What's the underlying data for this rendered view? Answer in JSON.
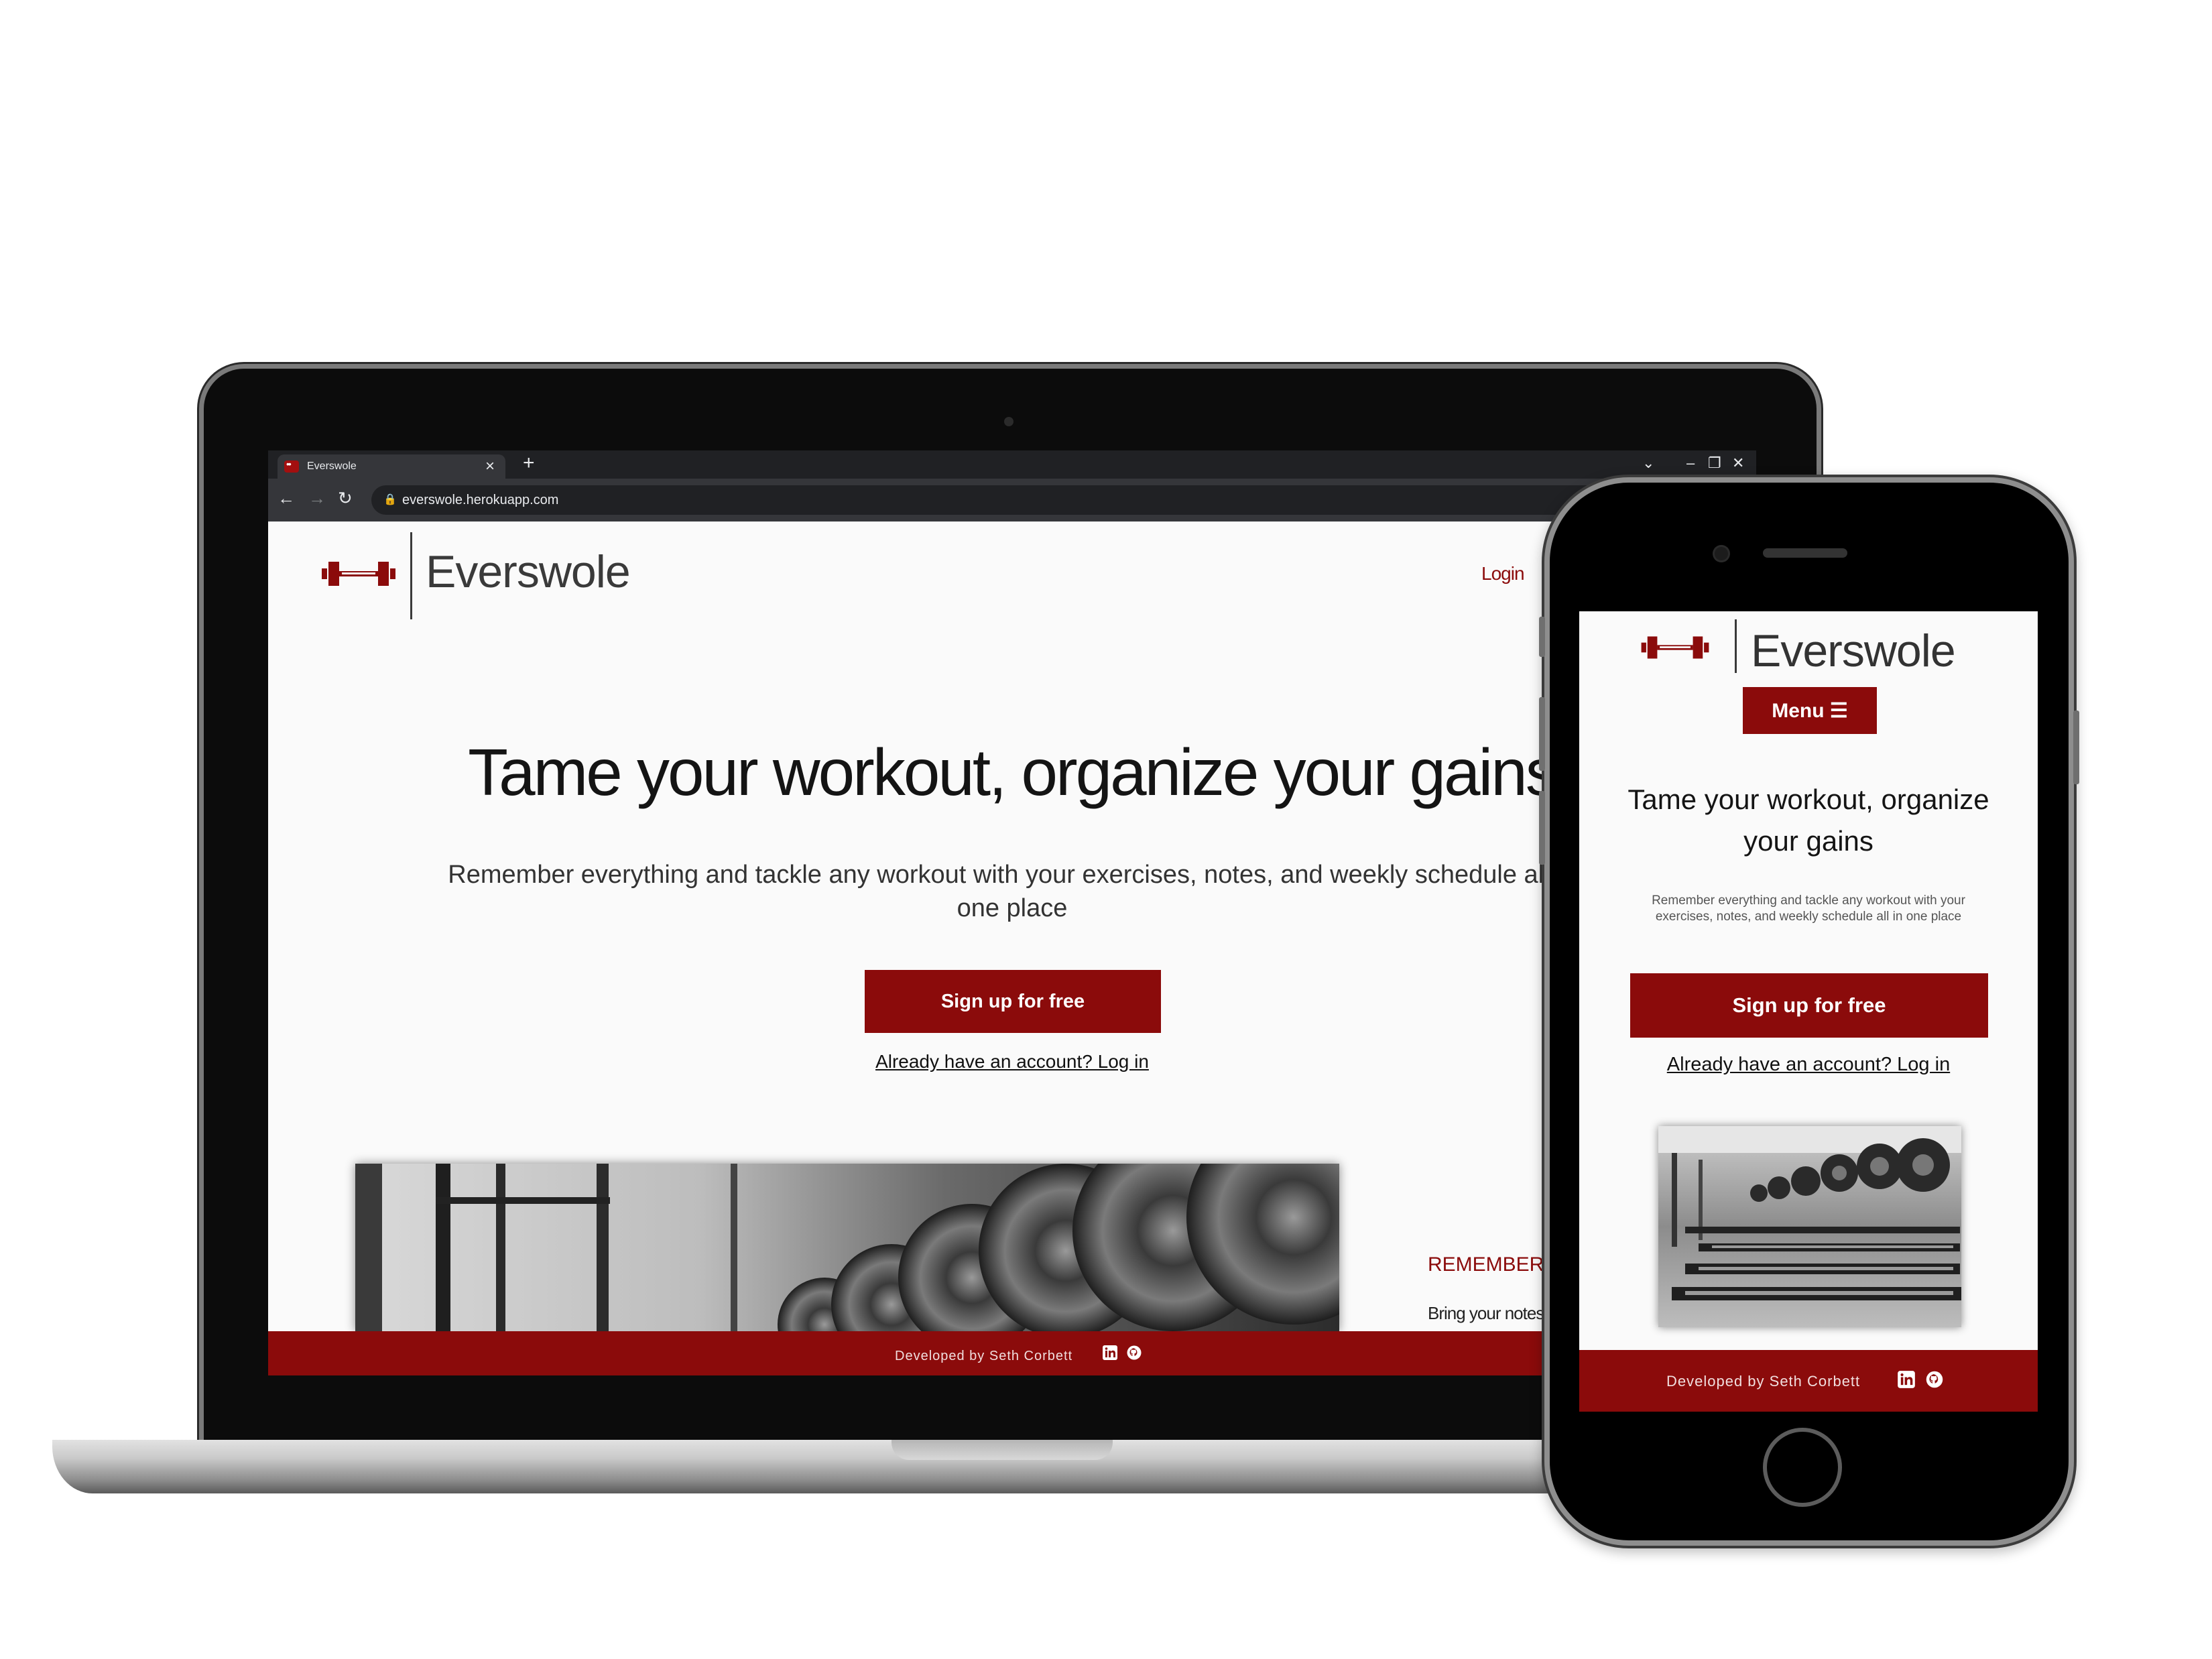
{
  "browser": {
    "tab_title": "Everswole",
    "tab_close": "×",
    "tab_new": "+",
    "url": "everswole.herokuapp.com",
    "window_controls": {
      "dropdown": "⌄",
      "minimize": "–",
      "restore": "❐",
      "close": "✕"
    },
    "nav": {
      "back": "←",
      "forward": "→",
      "reload": "↻"
    }
  },
  "brand": {
    "name": "Everswole",
    "accent": "#8b0b0b"
  },
  "desktop": {
    "nav": {
      "login": "Login"
    },
    "hero": {
      "title": "Tame your workout, organize your gains",
      "subtitle": "Remember everything and tackle any workout with your exercises, notes, and weekly schedule all in one place",
      "signup_label": "Sign up for free",
      "login_prompt": "Already have an account? Log in"
    },
    "feature": {
      "heading": "REMEMBER E",
      "text": "Bring your notes,"
    },
    "footer": {
      "credit": "Developed by Seth Corbett"
    }
  },
  "mobile": {
    "menu_label": "Menu ☰",
    "hero": {
      "title": "Tame your workout, organize your gains",
      "subtitle": "Remember everything and tackle any workout with your exercises, notes, and weekly schedule all in one place",
      "signup_label": "Sign up for free",
      "login_prompt": "Already have an account? Log in"
    },
    "footer": {
      "credit": "Developed by Seth Corbett"
    }
  },
  "icons": [
    "barbell-logo-icon",
    "linkedin-icon",
    "github-icon",
    "lock-icon",
    "share-icon",
    "star-icon"
  ]
}
